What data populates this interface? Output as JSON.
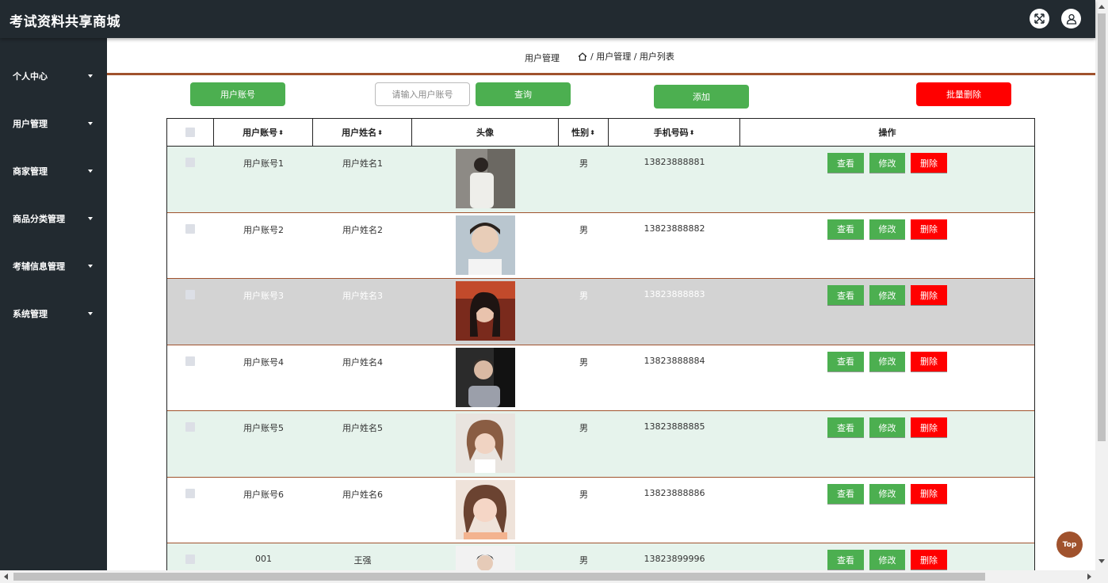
{
  "app": {
    "title": "考试资料共享商城"
  },
  "header": {
    "fullscreen_icon": "fullscreen-icon",
    "user_icon": "user-icon"
  },
  "sidebar": {
    "items": [
      {
        "label": "个人中心"
      },
      {
        "label": "用户管理"
      },
      {
        "label": "商家管理"
      },
      {
        "label": "商品分类管理"
      },
      {
        "label": "考辅信息管理"
      },
      {
        "label": "系统管理"
      }
    ]
  },
  "breadcrumb": {
    "title": "用户管理",
    "home_icon": "home-icon",
    "path": "/ 用户管理 / 用户列表"
  },
  "toolbar": {
    "filter_label": "用户账号",
    "search_placeholder": "请输入用户账号",
    "search_button": "查询",
    "add_button": "添加",
    "batch_delete_button": "批量删除"
  },
  "table": {
    "columns": [
      "用户账号",
      "用户姓名",
      "头像",
      "性别",
      "手机号码",
      "操作"
    ],
    "sort_glyph": "⬍",
    "actions": {
      "view": "查看",
      "edit": "修改",
      "delete": "删除"
    },
    "rows": [
      {
        "account": "用户账号1",
        "name": "用户姓名1",
        "gender": "男",
        "phone": "13823888881"
      },
      {
        "account": "用户账号2",
        "name": "用户姓名2",
        "gender": "男",
        "phone": "13823888882"
      },
      {
        "account": "用户账号3",
        "name": "用户姓名3",
        "gender": "男",
        "phone": "13823888883"
      },
      {
        "account": "用户账号4",
        "name": "用户姓名4",
        "gender": "男",
        "phone": "13823888884"
      },
      {
        "account": "用户账号5",
        "name": "用户姓名5",
        "gender": "男",
        "phone": "13823888885"
      },
      {
        "account": "用户账号6",
        "name": "用户姓名6",
        "gender": "男",
        "phone": "13823888886"
      },
      {
        "account": "001",
        "name": "王强",
        "gender": "男",
        "phone": "13823899996"
      }
    ]
  },
  "back_to_top": "Top",
  "colors": {
    "sidebar_bg": "#222a30",
    "accent_brown": "#a0522d",
    "green": "#4caf50",
    "red": "#ff0000",
    "row_alt": "#e6f3ec",
    "row_hover": "#d3d3d3"
  }
}
